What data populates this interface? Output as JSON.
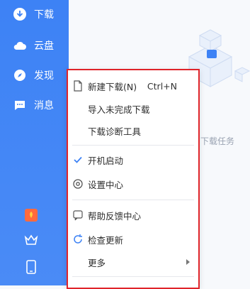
{
  "sidebar": {
    "items": [
      {
        "label": "下载",
        "icon": "download-icon"
      },
      {
        "label": "云盘",
        "icon": "cloud-icon"
      },
      {
        "label": "发现",
        "icon": "compass-icon"
      },
      {
        "label": "消息",
        "icon": "message-icon"
      }
    ],
    "bottom_icons": [
      "promo-gift-icon",
      "crown-icon",
      "mobile-icon"
    ]
  },
  "main": {
    "empty_text": "白下载任务"
  },
  "context_menu": {
    "items": [
      {
        "label": "新建下载(N)",
        "shortcut": "Ctrl+N",
        "icon": "new-file-icon"
      },
      {
        "label": "导入未完成下载"
      },
      {
        "label": "下载诊断工具"
      },
      {
        "label": "开机启动",
        "icon": "check-icon",
        "checked": true
      },
      {
        "label": "设置中心",
        "icon": "gear-icon"
      },
      {
        "label": "帮助反馈中心",
        "icon": "feedback-icon"
      },
      {
        "label": "检查更新",
        "icon": "refresh-icon"
      },
      {
        "label": "更多",
        "has_submenu": true
      }
    ]
  },
  "colors": {
    "sidebar": "#3d82f5",
    "menu_border": "#e0242a",
    "accent": "#3d82f5"
  }
}
